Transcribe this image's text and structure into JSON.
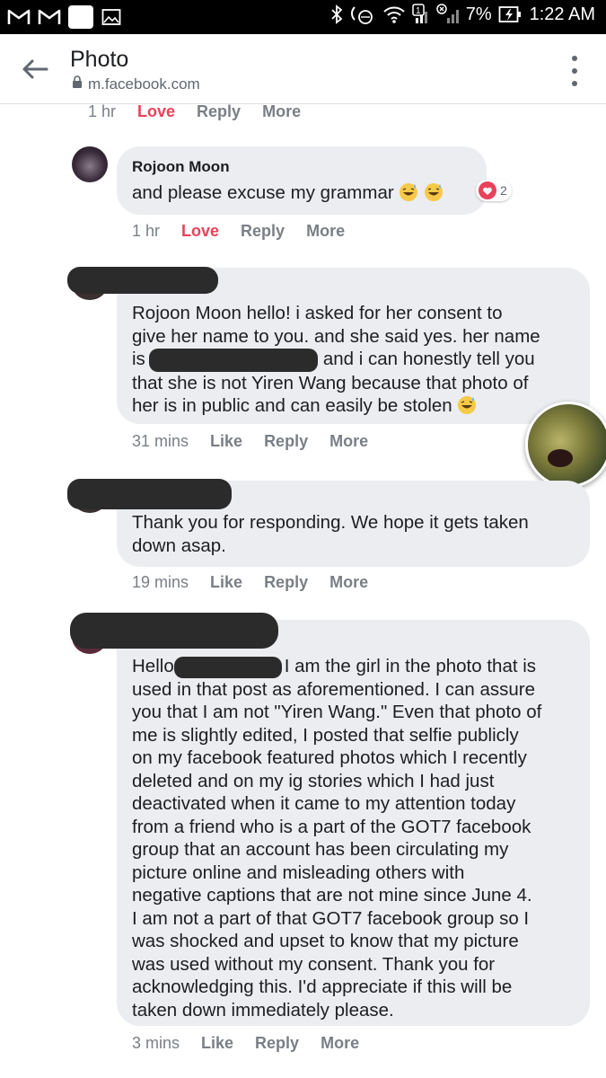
{
  "status_bar": {
    "battery": "7%",
    "time": "1:22 AM",
    "sim_badge": "1"
  },
  "header": {
    "title": "Photo",
    "url": "m.facebook.com"
  },
  "top_actions": {
    "time": "1 hr",
    "love": "Love",
    "reply": "Reply",
    "more": "More"
  },
  "comments": [
    {
      "author": "Rojoon Moon",
      "text": "and please excuse my grammar",
      "reaction_count": "2",
      "time": "1 hr",
      "react": "Love",
      "reply": "Reply",
      "more": "More"
    },
    {
      "lines": [
        "Rojoon Moon hello! i asked for her consent to",
        "give her name to you. and she said yes. her name",
        "is",
        "and i can honestly tell you",
        "that she is not Yiren Wang because that photo of",
        "her is in public and can easily be stolen"
      ],
      "time": "31 mins",
      "react": "Like",
      "reply": "Reply",
      "more": "More"
    },
    {
      "lines": [
        "Thank you for responding. We hope it gets taken",
        "down asap."
      ],
      "time": "19 mins",
      "react": "Like",
      "reply": "Reply",
      "more": "More"
    },
    {
      "lines": [
        "Hello",
        "I am the girl in the photo that is",
        "used in that post as aforementioned. I can assure",
        "you that I am not \"Yiren Wang.\" Even that photo of",
        "me is slightly edited, I posted that selfie publicly",
        "on my facebook featured photos which I recently",
        "deleted and on my ig stories which I had just",
        "deactivated when it came to my attention today",
        "from a friend who is a part of the GOT7 facebook",
        "group that an account has been circulating my",
        "picture online and misleading others with",
        "negative captions that are not mine since June 4.",
        "I am not a part of that GOT7 facebook group so I",
        "was shocked and upset to know that my picture",
        "was used without my consent. Thank you for",
        "acknowledging this. I'd appreciate if this will be",
        "taken down immediately please."
      ],
      "time": "3 mins",
      "react": "Like",
      "reply": "Reply",
      "more": "More"
    }
  ],
  "colors": {
    "love": "#e8425a",
    "bubble": "#ebedf0",
    "meta": "#7a7f87"
  }
}
